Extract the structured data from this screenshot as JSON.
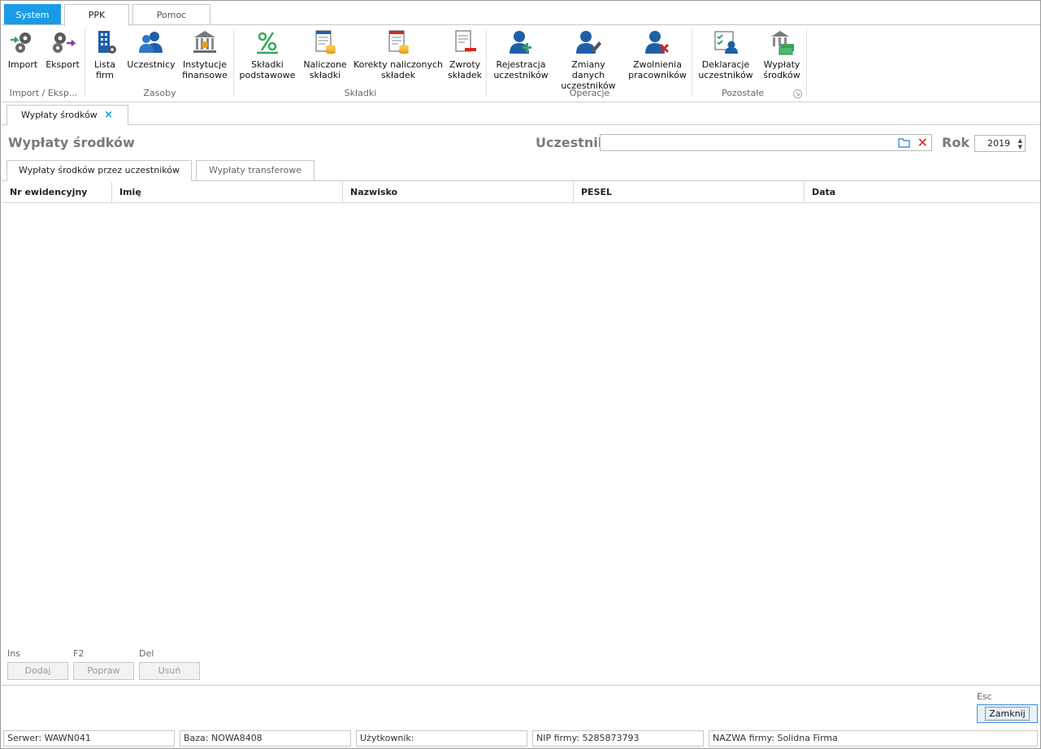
{
  "ribbon_tabs": [
    "System",
    "PPK",
    "Pomoc"
  ],
  "ribbon": {
    "groups": [
      {
        "label": "Import / Eksp...",
        "buttons": [
          {
            "label": "Import",
            "icon": "gears-import-icon"
          },
          {
            "label": "Eksport",
            "icon": "gears-export-icon"
          }
        ]
      },
      {
        "label": "Zasoby",
        "buttons": [
          {
            "label": "Lista\nfirm",
            "icon": "building-icon"
          },
          {
            "label": "Uczestnicy",
            "icon": "users-icon"
          },
          {
            "label": "Instytucje\nfinansowe",
            "icon": "bank-icon"
          }
        ]
      },
      {
        "label": "Składki",
        "buttons": [
          {
            "label": "Składki\npodstawowe",
            "icon": "percent-icon"
          },
          {
            "label": "Naliczone\nskładki",
            "icon": "document-coins-icon"
          },
          {
            "label": "Korekty naliczonych\nskładek",
            "icon": "document-coins-red-icon"
          },
          {
            "label": "Zwroty\nskładek",
            "icon": "document-minus-icon"
          }
        ]
      },
      {
        "label": "Operacje",
        "buttons": [
          {
            "label": "Rejestracja\nuczestników",
            "icon": "user-add-icon"
          },
          {
            "label": "Zmiany danych\nuczestników",
            "icon": "user-edit-icon"
          },
          {
            "label": "Zwolnienia\npracowników",
            "icon": "user-remove-icon"
          }
        ]
      },
      {
        "label": "Pozostałe",
        "buttons": [
          {
            "label": "Deklaracje\nuczestników",
            "icon": "declaration-icon"
          },
          {
            "label": "Wypłaty\nśrodków",
            "icon": "bank-money-icon"
          }
        ]
      }
    ]
  },
  "doc_tab": {
    "label": "Wypłaty środków",
    "close": "×"
  },
  "page_title": "Wypłaty środków",
  "filter": {
    "uczestnik_label": "Uczestnik",
    "uczestnik_value": "",
    "rok_label": "Rok",
    "rok_value": "2019"
  },
  "sub_tabs": [
    "Wypłaty środków przez uczestników",
    "Wypłaty transferowe"
  ],
  "grid": {
    "columns": [
      "Nr ewidencyjny",
      "Imię",
      "Nazwisko",
      "PESEL",
      "Data"
    ],
    "rows": []
  },
  "actions": [
    {
      "hotkey": "Ins",
      "label": "Dodaj"
    },
    {
      "hotkey": "F2",
      "label": "Popraw"
    },
    {
      "hotkey": "Del",
      "label": "Usuń"
    }
  ],
  "close": {
    "hotkey": "Esc",
    "label": "Zamknij"
  },
  "status_bar": [
    "Serwer: WAWN041",
    "Baza: NOWA8408",
    "Użytkownik:",
    "NIP firmy: 5285873793",
    "NAZWA firmy: Solidna Firma"
  ],
  "colors": {
    "accent": "#1a9be8",
    "icon_blue": "#1f5fa8",
    "icon_green": "#3aa65a",
    "icon_red": "#d6261f"
  }
}
